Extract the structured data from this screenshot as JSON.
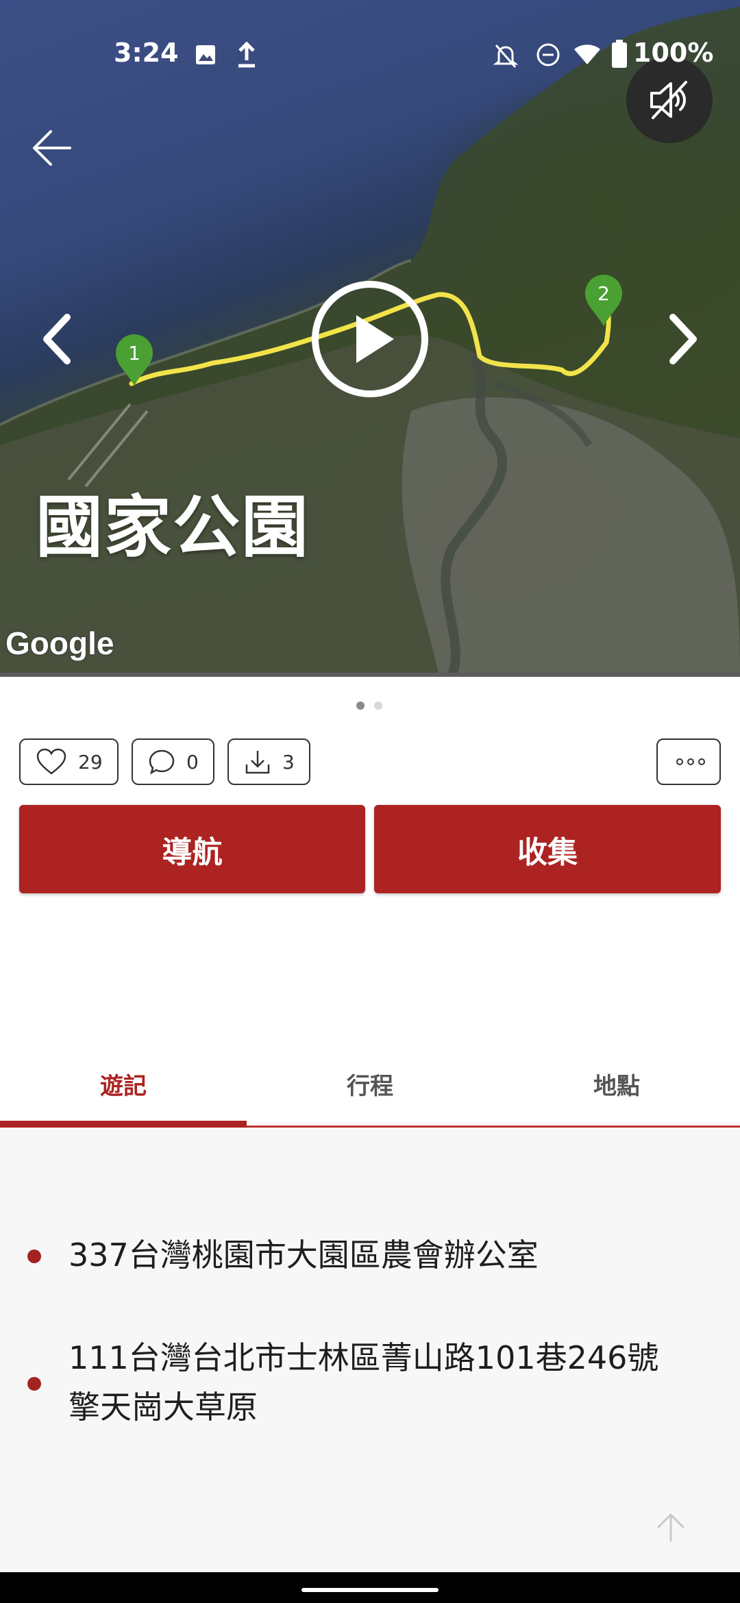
{
  "status_bar": {
    "time": "3:24",
    "battery": "100%",
    "left_icons": [
      "image-icon",
      "upload-icon"
    ],
    "right_icons": [
      "bell-off-icon",
      "dnd-icon",
      "wifi-icon",
      "battery-icon"
    ]
  },
  "hero": {
    "title": "國家公園",
    "attribution": "Google",
    "markers": [
      "1",
      "2"
    ],
    "colors": {
      "route": "#f2e34a",
      "marker": "#4aa033"
    }
  },
  "pager": {
    "count": 2,
    "active": 1
  },
  "stats": {
    "likes": "29",
    "comments": "0",
    "downloads": "3"
  },
  "actions": {
    "navigate_label": "導航",
    "collect_label": "收集"
  },
  "tabs": [
    {
      "label": "遊記",
      "active": true
    },
    {
      "label": "行程",
      "active": false
    },
    {
      "label": "地點",
      "active": false
    }
  ],
  "locations": [
    {
      "text": "337台灣桃園市大園區農會辦公室"
    },
    {
      "line1": "111台灣台北市士林區菁山路101巷246號",
      "line2": "擎天崗大草原"
    }
  ],
  "theme": {
    "accent": "#ac2322"
  }
}
